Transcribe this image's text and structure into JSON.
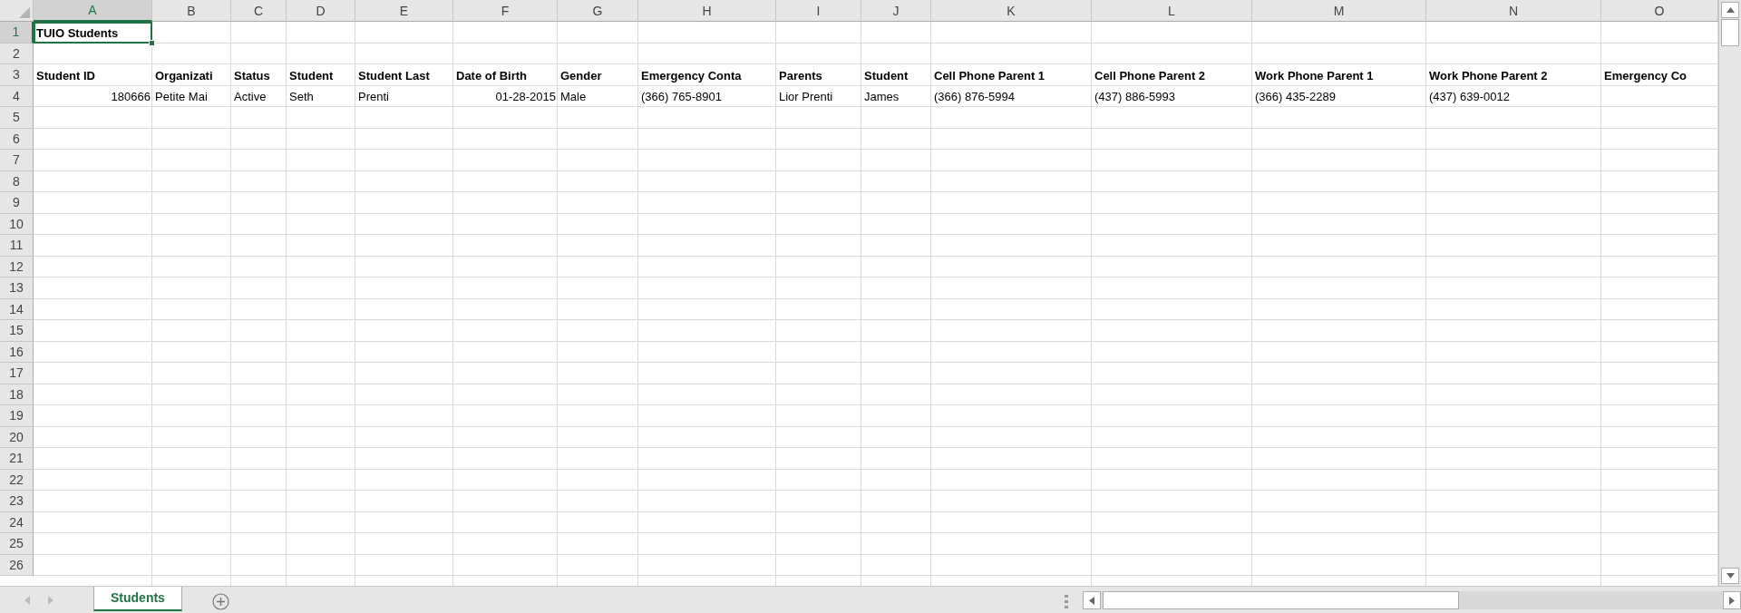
{
  "sheet": {
    "columns": [
      {
        "label": "A",
        "selected": true
      },
      {
        "label": "B",
        "selected": false
      },
      {
        "label": "C",
        "selected": false
      },
      {
        "label": "D",
        "selected": false
      },
      {
        "label": "E",
        "selected": false
      },
      {
        "label": "F",
        "selected": false
      },
      {
        "label": "G",
        "selected": false
      },
      {
        "label": "H",
        "selected": false
      },
      {
        "label": "I",
        "selected": false
      },
      {
        "label": "J",
        "selected": false
      },
      {
        "label": "K",
        "selected": false
      },
      {
        "label": "L",
        "selected": false
      },
      {
        "label": "M",
        "selected": false
      },
      {
        "label": "N",
        "selected": false
      },
      {
        "label": "O",
        "selected": false
      }
    ],
    "rows": [
      {
        "number": "1",
        "selected": true,
        "kind": "title",
        "cells": [
          {
            "text": "TUIO Students",
            "kind": "text",
            "selected": true
          }
        ]
      },
      {
        "number": "2",
        "selected": false,
        "kind": "data",
        "cells": []
      },
      {
        "number": "3",
        "selected": false,
        "kind": "header",
        "cells": [
          {
            "text": "Student ID",
            "kind": "text",
            "selected": false
          },
          {
            "text": "Organizati",
            "kind": "text",
            "selected": false
          },
          {
            "text": "Status",
            "kind": "text",
            "selected": false
          },
          {
            "text": "Student",
            "kind": "text",
            "selected": false
          },
          {
            "text": "Student Last",
            "kind": "text",
            "selected": false
          },
          {
            "text": "Date of Birth",
            "kind": "text",
            "selected": false
          },
          {
            "text": "Gender",
            "kind": "text",
            "selected": false
          },
          {
            "text": "Emergency Conta",
            "kind": "text",
            "selected": false
          },
          {
            "text": "Parents",
            "kind": "text",
            "selected": false
          },
          {
            "text": "Student",
            "kind": "text",
            "selected": false
          },
          {
            "text": "Cell Phone Parent 1",
            "kind": "text",
            "selected": false
          },
          {
            "text": "Cell Phone Parent 2",
            "kind": "text",
            "selected": false
          },
          {
            "text": "Work Phone Parent 1",
            "kind": "text",
            "selected": false
          },
          {
            "text": "Work Phone Parent 2",
            "kind": "text",
            "selected": false
          },
          {
            "text": "Emergency Co",
            "kind": "text",
            "selected": false
          }
        ]
      },
      {
        "number": "4",
        "selected": false,
        "kind": "data",
        "cells": [
          {
            "text": "180666",
            "kind": "number",
            "selected": false
          },
          {
            "text": "Petite Mai",
            "kind": "text",
            "selected": false
          },
          {
            "text": "Active",
            "kind": "text",
            "selected": false
          },
          {
            "text": "Seth",
            "kind": "text",
            "selected": false
          },
          {
            "text": "Prenti",
            "kind": "text",
            "selected": false
          },
          {
            "text": "01-28-2015",
            "kind": "number",
            "selected": false
          },
          {
            "text": "Male",
            "kind": "text",
            "selected": false
          },
          {
            "text": "(366) 765-8901",
            "kind": "text",
            "selected": false
          },
          {
            "text": "Lior Prenti",
            "kind": "text",
            "selected": false
          },
          {
            "text": "James",
            "kind": "text",
            "selected": false
          },
          {
            "text": "(366) 876-5994",
            "kind": "text",
            "selected": false
          },
          {
            "text": "(437) 886-5993",
            "kind": "text",
            "selected": false
          },
          {
            "text": "(366) 435-2289",
            "kind": "text",
            "selected": false
          },
          {
            "text": "(437) 639-0012",
            "kind": "text",
            "selected": false
          }
        ]
      },
      {
        "number": "5",
        "selected": false,
        "kind": "data",
        "cells": []
      },
      {
        "number": "6",
        "selected": false,
        "kind": "data",
        "cells": []
      },
      {
        "number": "7",
        "selected": false,
        "kind": "data",
        "cells": []
      },
      {
        "number": "8",
        "selected": false,
        "kind": "data",
        "cells": []
      },
      {
        "number": "9",
        "selected": false,
        "kind": "data",
        "cells": []
      },
      {
        "number": "10",
        "selected": false,
        "kind": "data",
        "cells": []
      },
      {
        "number": "11",
        "selected": false,
        "kind": "data",
        "cells": []
      },
      {
        "number": "12",
        "selected": false,
        "kind": "data",
        "cells": []
      },
      {
        "number": "13",
        "selected": false,
        "kind": "data",
        "cells": []
      },
      {
        "number": "14",
        "selected": false,
        "kind": "data",
        "cells": []
      },
      {
        "number": "15",
        "selected": false,
        "kind": "data",
        "cells": []
      },
      {
        "number": "16",
        "selected": false,
        "kind": "data",
        "cells": []
      },
      {
        "number": "17",
        "selected": false,
        "kind": "data",
        "cells": []
      },
      {
        "number": "18",
        "selected": false,
        "kind": "data",
        "cells": []
      },
      {
        "number": "19",
        "selected": false,
        "kind": "data",
        "cells": []
      },
      {
        "number": "20",
        "selected": false,
        "kind": "data",
        "cells": []
      },
      {
        "number": "21",
        "selected": false,
        "kind": "data",
        "cells": []
      },
      {
        "number": "22",
        "selected": false,
        "kind": "data",
        "cells": []
      },
      {
        "number": "23",
        "selected": false,
        "kind": "data",
        "cells": []
      },
      {
        "number": "24",
        "selected": false,
        "kind": "data",
        "cells": []
      },
      {
        "number": "25",
        "selected": false,
        "kind": "data",
        "cells": []
      },
      {
        "number": "26",
        "selected": false,
        "kind": "data",
        "cells": []
      }
    ]
  },
  "sheet_tabs": [
    {
      "label": "Students",
      "selected": true
    }
  ]
}
